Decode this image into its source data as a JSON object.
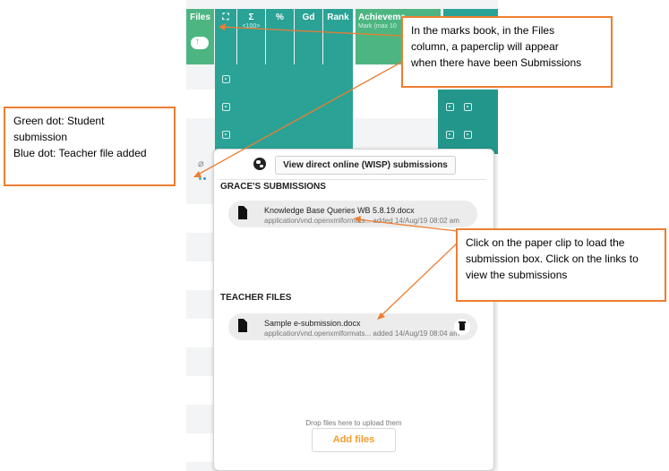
{
  "marks_book": {
    "columns": [
      {
        "label": "Files",
        "sub": ""
      },
      {
        "label": "⛶",
        "sub": ""
      },
      {
        "label": "Σ",
        "sub": "<100>"
      },
      {
        "label": "%",
        "sub": ""
      },
      {
        "label": "Gd",
        "sub": ""
      },
      {
        "label": "Rank",
        "sub": ""
      },
      {
        "label": "Achieveme",
        "sub": "Mark (max 10"
      }
    ],
    "status_colors": {
      "student_dot": "#4db581",
      "teacher_dot": "#3a8fd8",
      "files_header": "#4db581",
      "grade_header": "#2aa296"
    }
  },
  "popup": {
    "wisp_button_label": "View direct online (WISP) submissions",
    "student_section_title": "GRACE'S SUBMISSIONS",
    "student_files": [
      {
        "name": "Knowledge Base Queries WB 5.8.19.docx",
        "meta": "application/vnd.openxmlformats... added 14/Aug/19 08:02 am"
      }
    ],
    "teacher_section_title": "TEACHER FILES",
    "teacher_files": [
      {
        "name": "Sample e-submission.docx",
        "meta": "application/vnd.openxmlformats... added 14/Aug/19 08:04 am"
      }
    ],
    "drop_text": "Drop files here to upload them",
    "add_files_label": "Add files",
    "accent_color": "#f39c2b"
  },
  "callouts": {
    "top": [
      "In the marks book, in the Files",
      "column, a paperclip will appear",
      "when there have been Submissions"
    ],
    "left": [
      "Green dot: Student",
      "submission",
      "Blue dot: Teacher file added"
    ],
    "right": [
      "Click on the paper clip to load the",
      "submission box. Click on the links to",
      "view the submissions"
    ],
    "border_color": "#ed7d31"
  }
}
